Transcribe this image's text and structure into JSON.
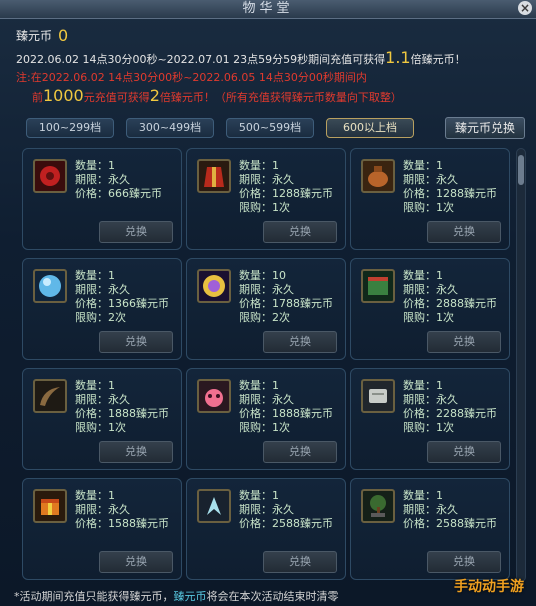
{
  "window": {
    "title": "物华堂",
    "close_label": "×"
  },
  "currency": {
    "label": "臻元币",
    "value": "0"
  },
  "info": {
    "line1_prefix": "2022.06.02 14点30分00秒~2022.07.01 23点59分59秒期间充值可获得",
    "line1_multiplier": "1.1",
    "line1_suffix": "倍臻元币！",
    "line2": "注:在2022.06.02 14点30分00秒~2022.06.05 14点30分00秒期间内",
    "line3_prefix": "前",
    "line3_amount": "1000",
    "line3_middle": "元充值可获得",
    "line3_multiplier": "2",
    "line3_suffix": "倍臻元币！（所有充值获得臻元币数量向下取整）"
  },
  "tabs": [
    {
      "label": "100~299档",
      "active": false
    },
    {
      "label": "300~499档",
      "active": false
    },
    {
      "label": "500~599档",
      "active": false
    },
    {
      "label": "600以上档",
      "active": true
    }
  ],
  "exchange_top_label": "臻元币兑换",
  "item_labels": {
    "qty": "数量：",
    "period": "期限：",
    "price": "价格：",
    "limit": "限购："
  },
  "exchange_button_label": "兑换",
  "items": [
    {
      "icon": "red-flower-icon",
      "qty": "1",
      "period": "永久",
      "price": "666臻元币",
      "limit": ""
    },
    {
      "icon": "red-robe-icon",
      "qty": "1",
      "period": "永久",
      "price": "1288臻元币",
      "limit": "1次"
    },
    {
      "icon": "treasure-bag-icon",
      "qty": "1",
      "period": "永久",
      "price": "1288臻元币",
      "limit": "1次"
    },
    {
      "icon": "blue-orb-icon",
      "qty": "1",
      "period": "永久",
      "price": "1366臻元币",
      "limit": "2次"
    },
    {
      "icon": "golden-medallion-icon",
      "qty": "10",
      "period": "永久",
      "price": "1788臻元币",
      "limit": "2次"
    },
    {
      "icon": "green-scroll-icon",
      "qty": "1",
      "period": "永久",
      "price": "2888臻元币",
      "limit": "1次"
    },
    {
      "icon": "horn-icon",
      "qty": "1",
      "period": "永久",
      "price": "1888臻元币",
      "limit": "1次"
    },
    {
      "icon": "pink-pet-icon",
      "qty": "1",
      "period": "永久",
      "price": "1888臻元币",
      "limit": "1次"
    },
    {
      "icon": "stone-tablet-icon",
      "qty": "1",
      "period": "永久",
      "price": "2288臻元币",
      "limit": "1次"
    },
    {
      "icon": "gift-box-icon",
      "qty": "1",
      "period": "永久",
      "price": "1588臻元币",
      "limit": ""
    },
    {
      "icon": "crystal-wings-icon",
      "qty": "1",
      "period": "永久",
      "price": "2588臻元币",
      "limit": ""
    },
    {
      "icon": "bonsai-tree-icon",
      "qty": "1",
      "period": "永久",
      "price": "2588臻元币",
      "limit": ""
    }
  ],
  "footer": {
    "prefix": "*活动期间充值只能获得臻元币，",
    "highlight": "臻元币",
    "suffix": "将会在本次活动结束时清零"
  },
  "watermark": "手动动手游"
}
